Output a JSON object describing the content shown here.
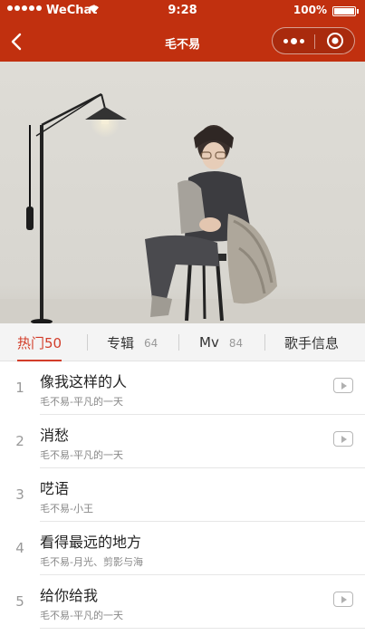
{
  "status_bar": {
    "carrier": "WeChat",
    "time": "9:28",
    "battery": "100%"
  },
  "nav": {
    "title": "毛不易",
    "icons": [
      "back-arrow-icon",
      "more-dots-icon",
      "close-target-icon"
    ]
  },
  "banner": {
    "image": "singer-photo"
  },
  "tabs": [
    {
      "label": "热门50",
      "count": "",
      "active": true
    },
    {
      "label": "专辑",
      "count": "64",
      "active": false
    },
    {
      "label": "Mv",
      "count": "84",
      "active": false
    },
    {
      "label": "歌手信息",
      "count": "",
      "active": false
    }
  ],
  "songs": [
    {
      "index": "1",
      "name": "像我这样的人",
      "subtitle": "毛不易-平凡的一天",
      "has_mv": true
    },
    {
      "index": "2",
      "name": "消愁",
      "subtitle": "毛不易-平凡的一天",
      "has_mv": true
    },
    {
      "index": "3",
      "name": "呓语",
      "subtitle": "毛不易-小王",
      "has_mv": false
    },
    {
      "index": "4",
      "name": "看得最远的地方",
      "subtitle": "毛不易-月光、剪影与海",
      "has_mv": false
    },
    {
      "index": "5",
      "name": "给你给我",
      "subtitle": "毛不易-平凡的一天",
      "has_mv": true
    }
  ],
  "colors": {
    "nav_bar": "#c1300f",
    "accent": "#d23d2a",
    "tab_bar": "#f4f4f4"
  }
}
